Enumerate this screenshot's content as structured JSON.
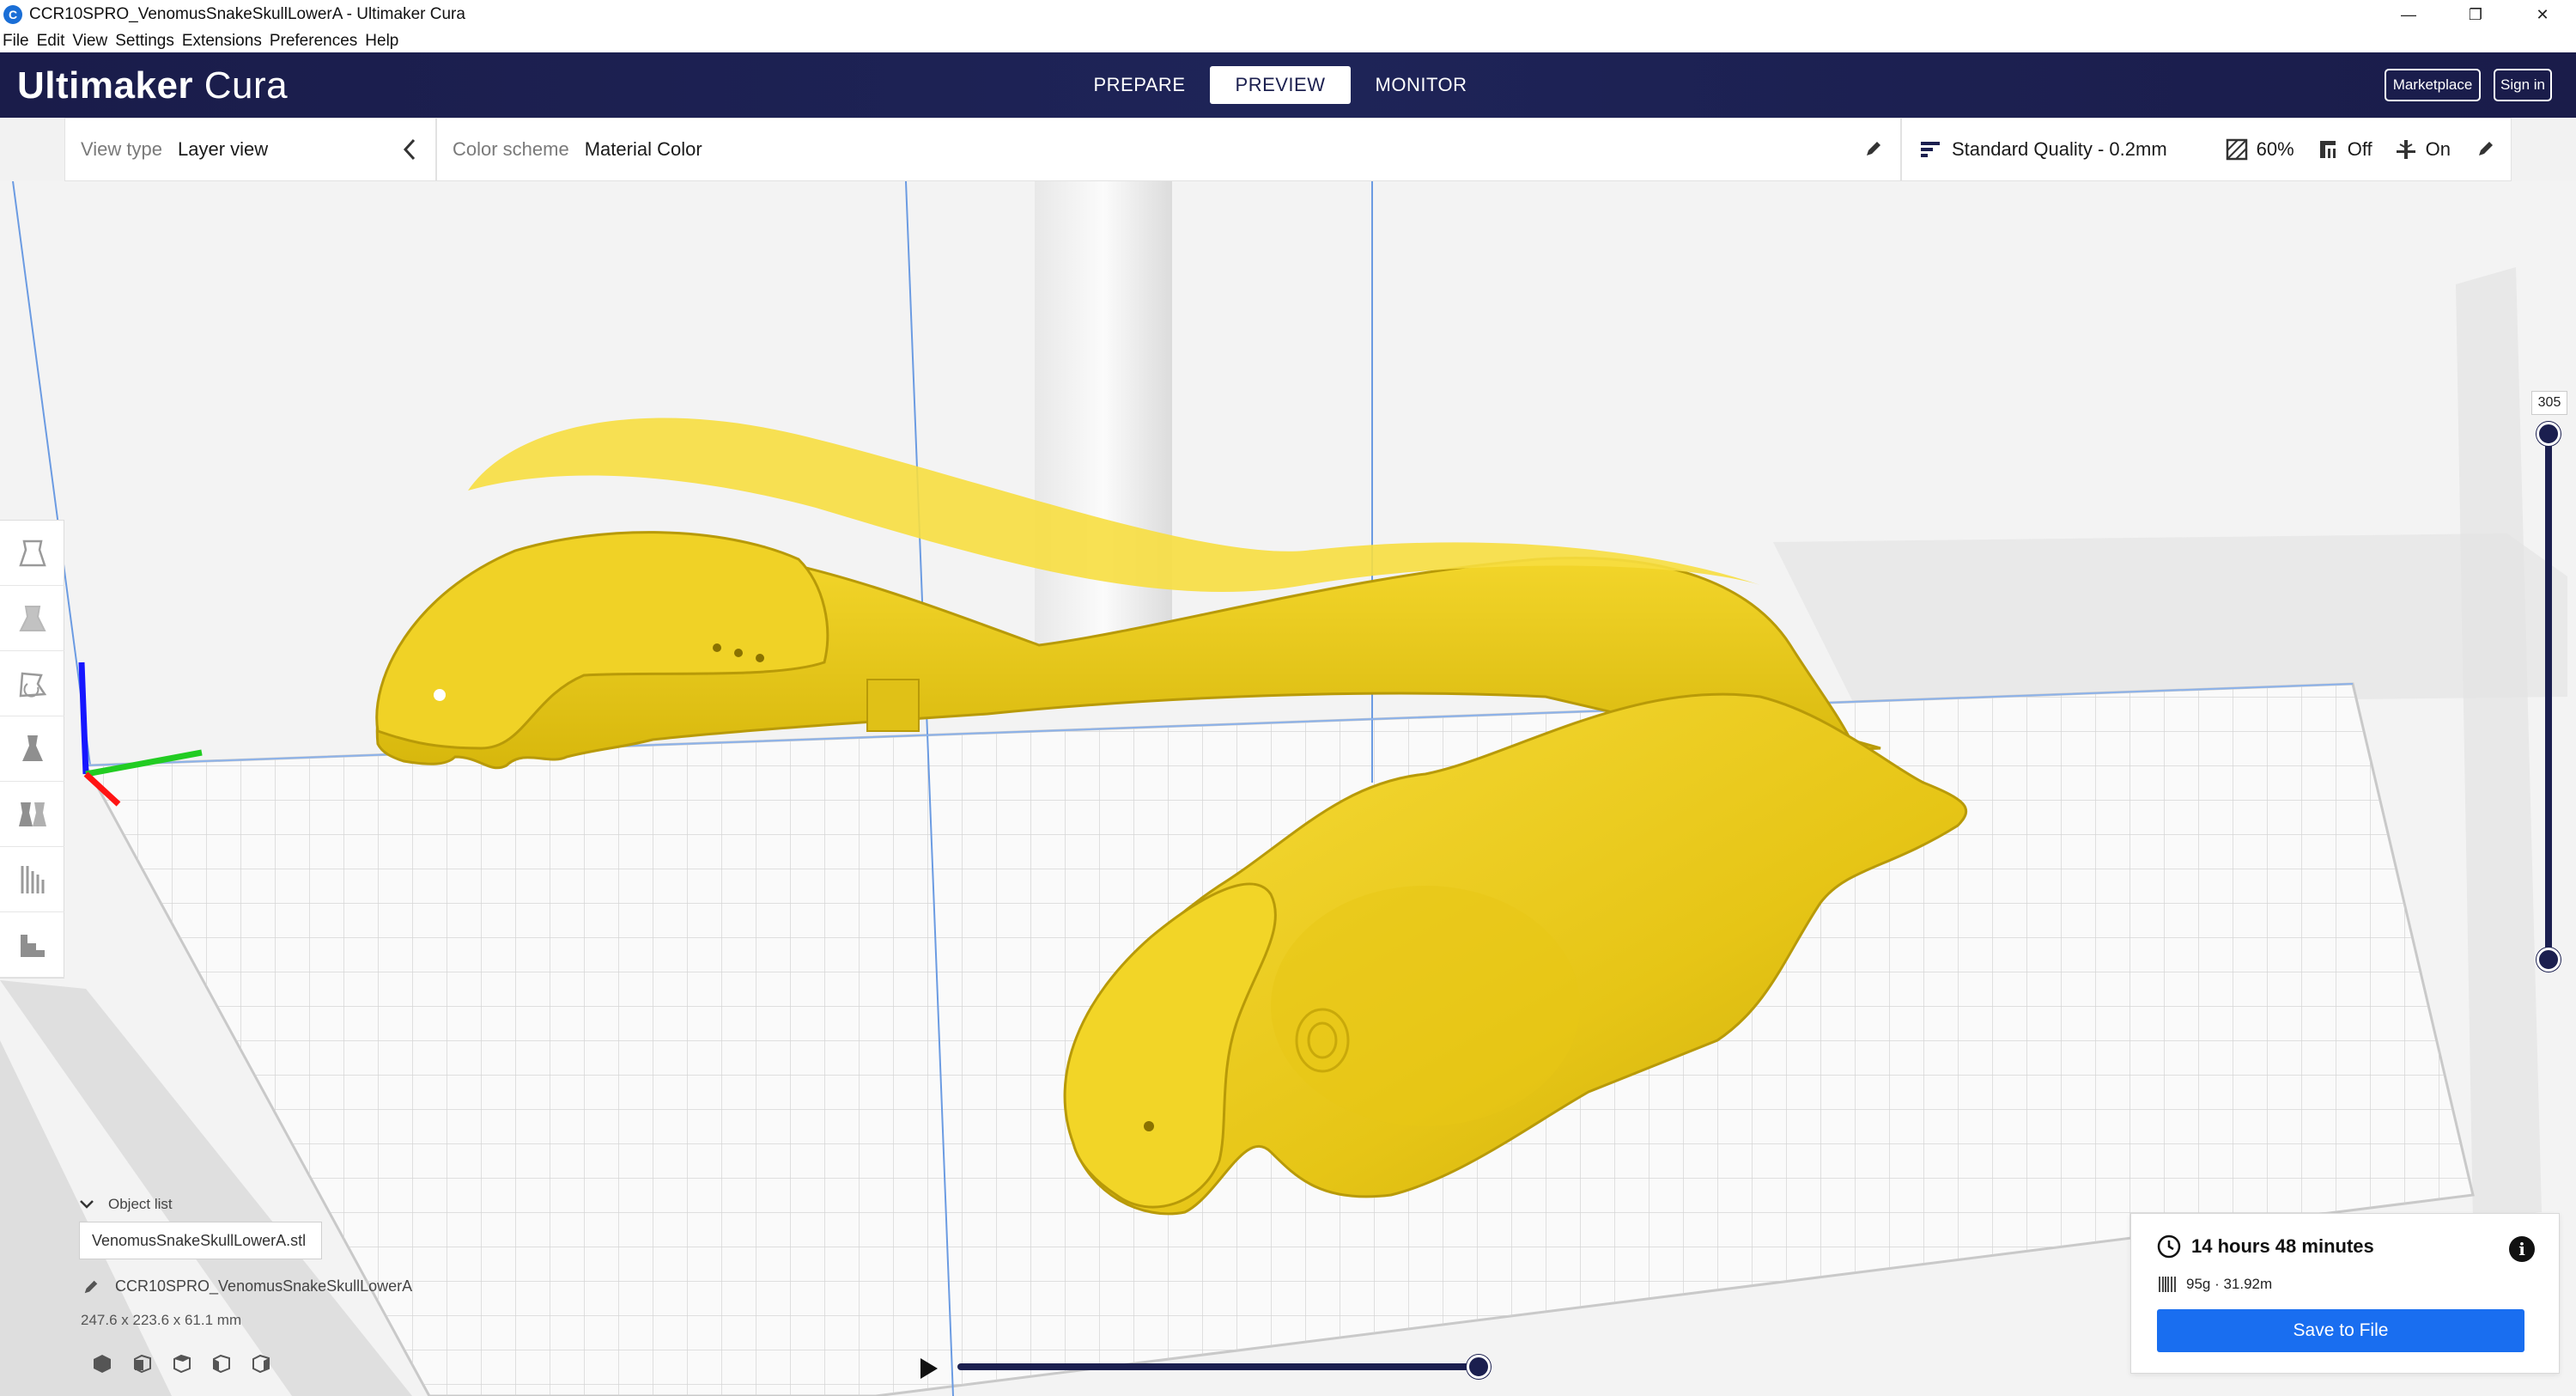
{
  "window": {
    "title": "CCR10SPRO_VenomusSnakeSkullLowerA - Ultimaker Cura",
    "app_icon_letter": "C",
    "minimize": "—",
    "maximize": "❐",
    "close": "✕"
  },
  "menubar": {
    "items": [
      "File",
      "Edit",
      "View",
      "Settings",
      "Extensions",
      "Preferences",
      "Help"
    ]
  },
  "header": {
    "logo_bold": "Ultimaker",
    "logo_light": "Cura",
    "stages": [
      {
        "label": "PREPARE",
        "active": false
      },
      {
        "label": "PREVIEW",
        "active": true
      },
      {
        "label": "MONITOR",
        "active": false
      }
    ],
    "marketplace_label": "Marketplace",
    "signin_label": "Sign in"
  },
  "view_panel": {
    "view_type_label": "View type",
    "view_type_value": "Layer view",
    "color_scheme_label": "Color scheme",
    "color_scheme_value": "Material Color"
  },
  "print_settings": {
    "profile": "Standard Quality - 0.2mm",
    "infill": "60%",
    "support": "Off",
    "adhesion": "On"
  },
  "layer_slider": {
    "value": "305",
    "max_layer": 305,
    "min_fraction": 0,
    "max_fraction": 1
  },
  "timeline": {
    "progress": 1.0
  },
  "object_list": {
    "header": "Object list",
    "file": "VenomusSnakeSkullLowerA.stl",
    "job_name": "CCR10SPRO_VenomusSnakeSkullLowerA",
    "dimensions": "247.6 x 223.6 x 61.1 mm"
  },
  "print_info": {
    "time": "14 hours 48 minutes",
    "material": "95g · 31.92m",
    "save_label": "Save to File",
    "info_glyph": "i"
  },
  "colors": {
    "header_bg": "#1b1f4f",
    "accent_blue": "#196ef0",
    "model_yellow": "#f2d21e",
    "build_plate": "#fafafa"
  }
}
